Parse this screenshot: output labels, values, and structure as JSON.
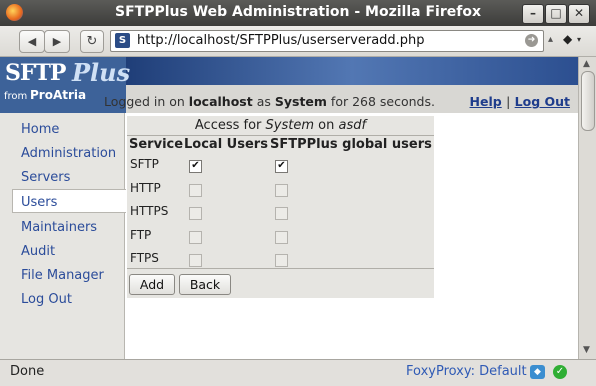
{
  "window": {
    "title": "SFTPPlus Web Administration - Mozilla Firefox",
    "buttons": [
      "–",
      "□",
      "✕"
    ]
  },
  "nav": {
    "back": "◀",
    "forward": "▶",
    "reload": "↻",
    "url": "http://localhost/SFTPPlus/userserveradd.php",
    "site_icon": "S",
    "apple": "◆"
  },
  "header": {
    "logo_sftp": "SFTP",
    "logo_plus": "Plus",
    "logo_from": "from",
    "logo_proatria": "ProAtria",
    "login_prefix": "Logged in on",
    "host": "localhost",
    "as": "as",
    "user": "System",
    "login_suffix": "for 268 seconds.",
    "help": "Help",
    "separator": "|",
    "logout": "Log Out"
  },
  "sidebar": {
    "items": [
      {
        "label": "Home"
      },
      {
        "label": "Administration"
      },
      {
        "label": "Servers"
      },
      {
        "label": "Users"
      },
      {
        "label": "Maintainers"
      },
      {
        "label": "Audit"
      },
      {
        "label": "File Manager"
      },
      {
        "label": "Log Out"
      }
    ],
    "active": "Users"
  },
  "access": {
    "caption_prefix": "Access for",
    "user": "System",
    "caption_mid": "on",
    "server": "asdf",
    "col_service": "Service",
    "col_local": "Local Users",
    "col_global": "SFTPPlus global users",
    "rows": [
      {
        "service": "SFTP",
        "local": true,
        "global": true,
        "enabled": true
      },
      {
        "service": "HTTP",
        "local": false,
        "global": false,
        "enabled": false
      },
      {
        "service": "HTTPS",
        "local": false,
        "global": false,
        "enabled": false
      },
      {
        "service": "FTP",
        "local": false,
        "global": false,
        "enabled": false
      },
      {
        "service": "FTPS",
        "local": false,
        "global": false,
        "enabled": false
      }
    ],
    "add_label": "Add",
    "back_label": "Back"
  },
  "statusbar": {
    "status": "Done",
    "foxyproxy": "FoxyProxy: Default"
  },
  "colors": {
    "link": "#2b4c9a",
    "banner": "#3d6299",
    "panel": "#e6e5e1"
  }
}
